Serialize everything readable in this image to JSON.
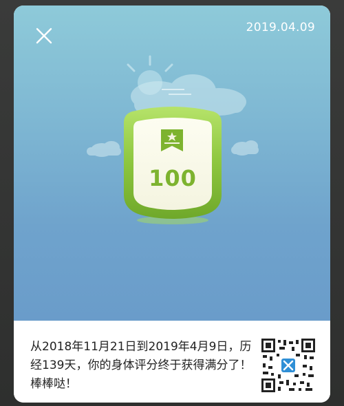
{
  "card": {
    "date": "2019.04.09",
    "badge": {
      "score": "100",
      "icon": "ribbon-star-icon"
    },
    "message": "从2018年11月21日到2019年4月9日，历经139天，你的身体评分终于获得满分了！棒棒哒！",
    "close_icon": "close-icon",
    "qr_icon": "qr-code-icon"
  },
  "colors": {
    "sky_top": "#8ecad9",
    "sky_bottom": "#6a9cca",
    "badge_green": "#8dc63f",
    "score_green": "#7db32f",
    "qr_blue": "#2f8fd6"
  }
}
